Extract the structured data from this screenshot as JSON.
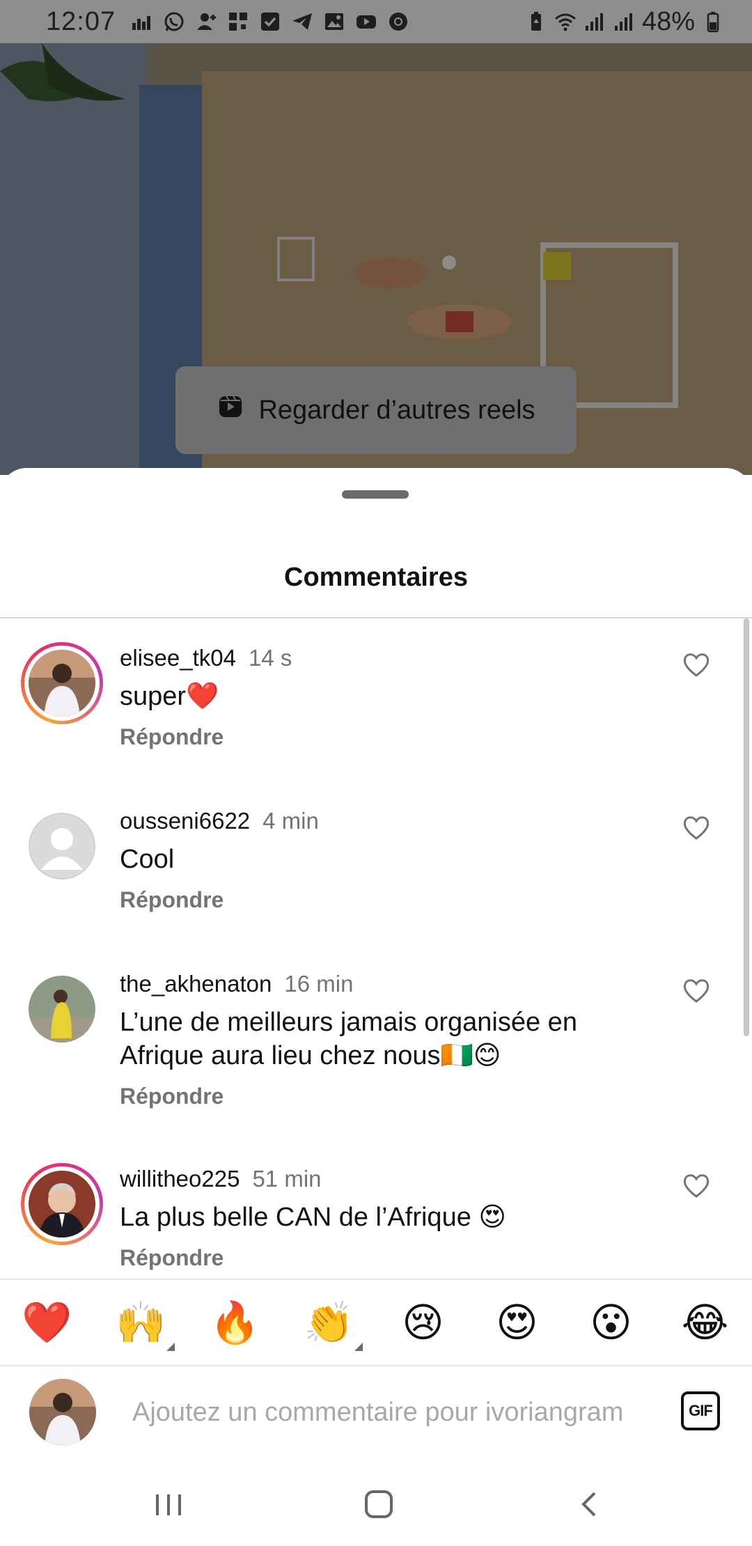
{
  "status_bar": {
    "time": "12:07",
    "battery": "48%",
    "icons": [
      "data-saver-icon",
      "whatsapp-icon",
      "add-person-icon",
      "qr-grid-icon",
      "checkbox-icon",
      "telegram-icon",
      "gallery-icon",
      "youtube-icon",
      "chrome-icon"
    ],
    "right_icons": [
      "battery-saver-icon",
      "wifi-icon",
      "signal-icon",
      "signal-icon",
      "battery-icon"
    ]
  },
  "background": {
    "reels_button_label": "Regarder d’autres reels"
  },
  "sheet": {
    "title": "Commentaires"
  },
  "comments": [
    {
      "username": "elisee_tk04",
      "time": "14 s",
      "text": "super❤️",
      "reply": "Répondre",
      "has_story": true
    },
    {
      "username": "ousseni6622",
      "time": "4 min",
      "text": "Cool",
      "reply": "Répondre",
      "has_story": false
    },
    {
      "username": "the_akhenaton",
      "time": "16 min",
      "text": "L’une de meilleurs jamais organisée en Afrique aura lieu chez nous🇨🇮😊",
      "reply": "Répondre",
      "has_story": false
    },
    {
      "username": "willitheo225",
      "time": "51 min",
      "text": "La plus belle CAN de l’Afrique 😍",
      "reply": "Répondre",
      "has_story": true
    }
  ],
  "emoji_bar": [
    "❤️",
    "🙌",
    "🔥",
    "👏",
    "😢",
    "😍",
    "😮",
    "😂"
  ],
  "input": {
    "placeholder": "Ajoutez un commentaire pour ivoriangram",
    "gif_label": "GIF"
  },
  "nav": [
    "recent-apps-icon",
    "home-icon",
    "back-icon"
  ]
}
